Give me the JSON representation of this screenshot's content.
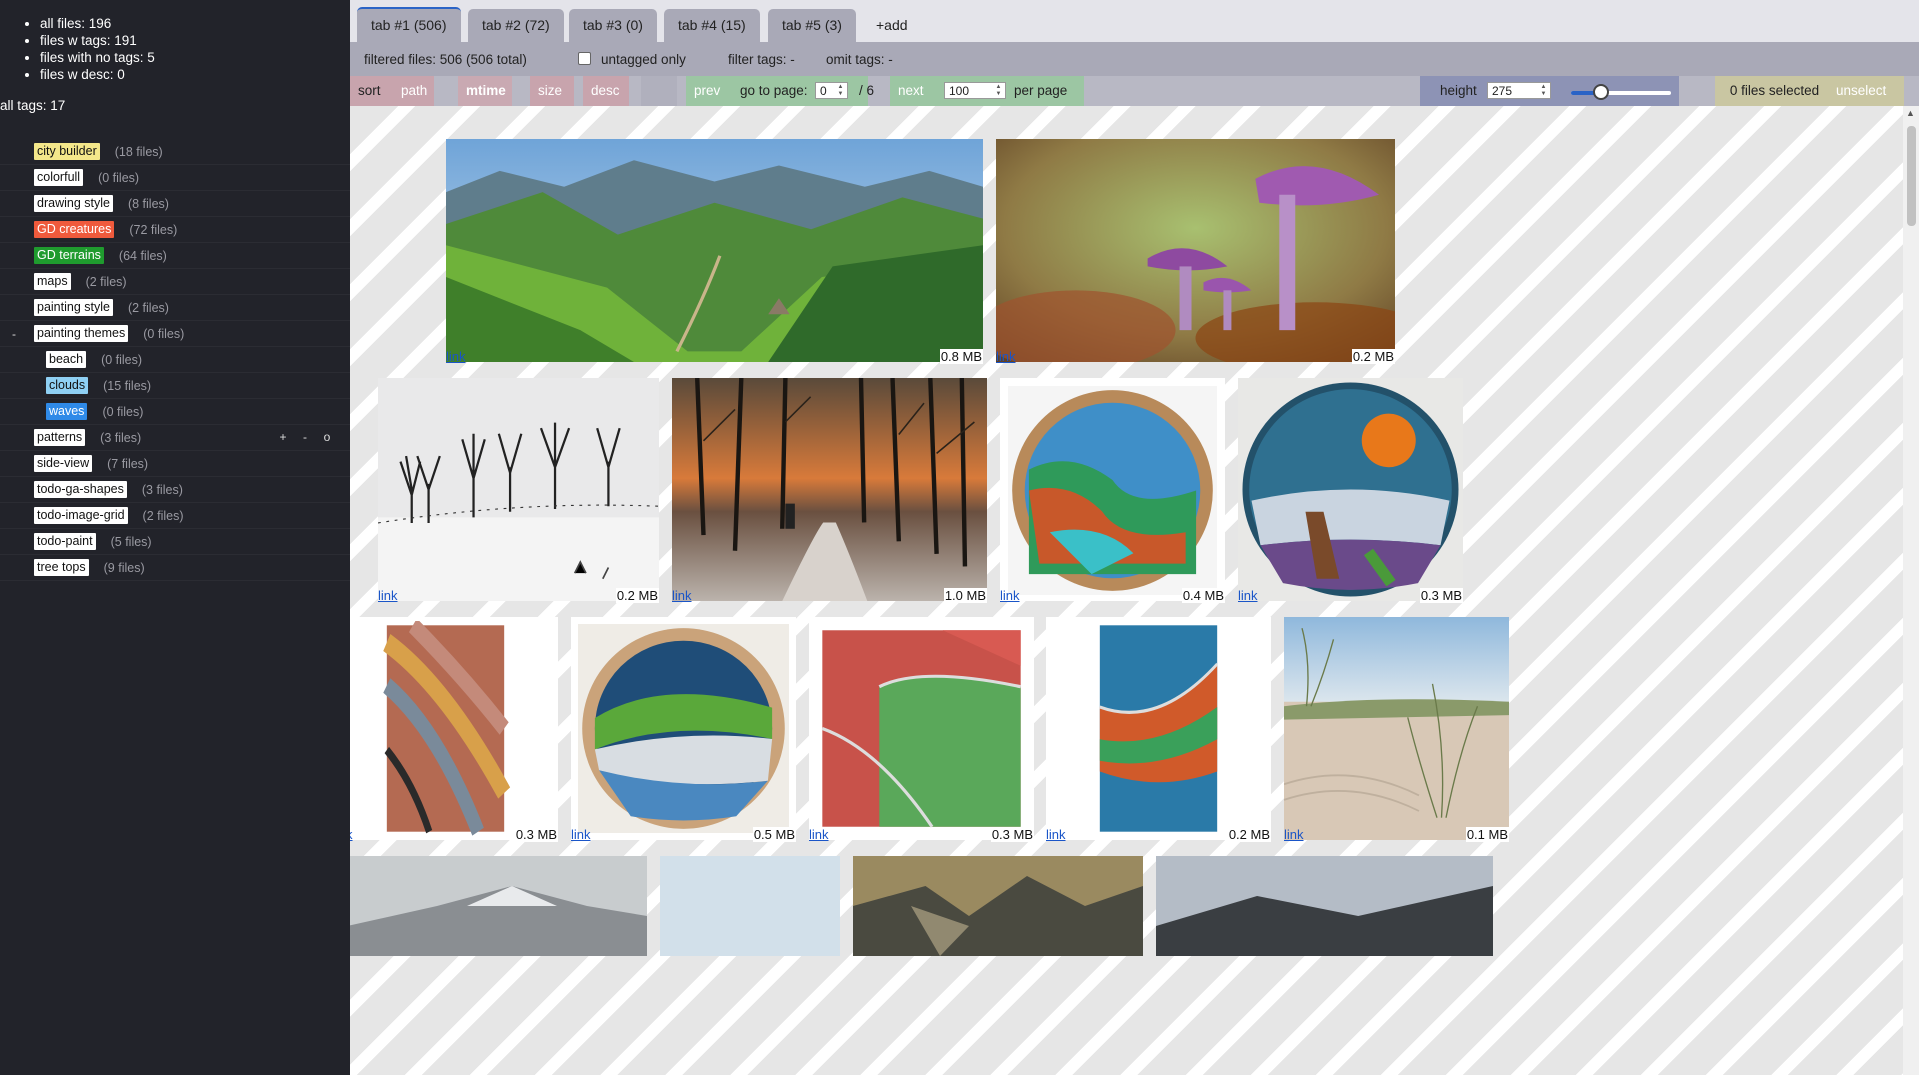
{
  "sidebar": {
    "stats": [
      "all files: 196",
      "files w tags: 191",
      "files with no tags: 5",
      "files w desc: 0"
    ],
    "all_tags": "all tags: 17",
    "tags": [
      {
        "label": "city builder",
        "count": "(18 files)",
        "color": "#f4e78a",
        "text_color": "#111"
      },
      {
        "label": "colorfull",
        "count": "(0 files)",
        "color": "#ffffff",
        "text_color": "#111"
      },
      {
        "label": "drawing style",
        "count": "(8 files)",
        "color": "#ffffff",
        "text_color": "#111"
      },
      {
        "label": "GD creatures",
        "count": "(72 files)",
        "color": "#ef5a3c",
        "text_color": "#fff"
      },
      {
        "label": "GD terrains",
        "count": "(64 files)",
        "color": "#1f9b2e",
        "text_color": "#fff"
      },
      {
        "label": "maps",
        "count": "(2 files)",
        "color": "#ffffff",
        "text_color": "#111"
      },
      {
        "label": "painting style",
        "count": "(2 files)",
        "color": "#ffffff",
        "text_color": "#111"
      },
      {
        "label": "painting themes",
        "count": "(0 files)",
        "color": "#ffffff",
        "text_color": "#111",
        "expander": "-"
      },
      {
        "label": "beach",
        "count": "(0 files)",
        "color": "#ffffff",
        "text_color": "#111",
        "child": true
      },
      {
        "label": "clouds",
        "count": "(15 files)",
        "color": "#8fd0f4",
        "text_color": "#111",
        "child": true
      },
      {
        "label": "waves",
        "count": "(0 files)",
        "color": "#2f8ae8",
        "text_color": "#fff",
        "child": true
      },
      {
        "label": "patterns",
        "count": "(3 files)",
        "color": "#ffffff",
        "text_color": "#111",
        "tools": [
          "+",
          "-",
          "o"
        ]
      },
      {
        "label": "side-view",
        "count": "(7 files)",
        "color": "#ffffff",
        "text_color": "#111"
      },
      {
        "label": "todo-ga-shapes",
        "count": "(3 files)",
        "color": "#ffffff",
        "text_color": "#111"
      },
      {
        "label": "todo-image-grid",
        "count": "(2 files)",
        "color": "#ffffff",
        "text_color": "#111"
      },
      {
        "label": "todo-paint",
        "count": "(5 files)",
        "color": "#ffffff",
        "text_color": "#111"
      },
      {
        "label": "tree tops",
        "count": "(9 files)",
        "color": "#ffffff",
        "text_color": "#111"
      }
    ]
  },
  "tabs": [
    {
      "label": "tab #1 (506)",
      "active": true
    },
    {
      "label": "tab #2 (72)"
    },
    {
      "label": "tab #3 (0)"
    },
    {
      "label": "tab #4 (15)"
    },
    {
      "label": "tab #5 (3)"
    }
  ],
  "add_tab_label": "+add",
  "filter": {
    "filtered": "filtered files: 506 (506 total)",
    "untagged_only": "untagged only",
    "filter_tags": "filter tags: -",
    "omit_tags": "omit tags: -"
  },
  "toolbar": {
    "sort": "sort",
    "path": "path",
    "mtime": "mtime",
    "size": "size",
    "desc": "desc",
    "prev": "prev",
    "goto": "go to page:",
    "page_value": "0",
    "page_total": "/ 6",
    "next": "next",
    "per_page_value": "100",
    "per_page": "per page",
    "height": "height",
    "height_value": "275",
    "slider_fraction": 0.3,
    "selected": "0 files selected",
    "unselect": "unselect"
  },
  "gallery": {
    "link_label": "link",
    "items": [
      {
        "size": "0.8 MB",
        "scene": "valley"
      },
      {
        "size": "0.2 MB",
        "scene": "mushroom"
      },
      {
        "size": "0.2 MB",
        "scene": "snow-trees"
      },
      {
        "size": "1.0 MB",
        "scene": "forest-sunset"
      },
      {
        "size": "0.4 MB",
        "scene": "mosaic-round-a"
      },
      {
        "size": "0.3 MB",
        "scene": "mosaic-round-b"
      },
      {
        "size": "0.3 MB",
        "scene": "mosaic-stones"
      },
      {
        "size": "0.5 MB",
        "scene": "mosaic-round-c"
      },
      {
        "size": "0.3 MB",
        "scene": "mosaic-green"
      },
      {
        "size": "0.2 MB",
        "scene": "mosaic-blue"
      },
      {
        "size": "0.1 MB",
        "scene": "dunes"
      },
      {
        "scene": "mountain-grey"
      },
      {
        "scene": "sky"
      },
      {
        "scene": "mountain-gold"
      },
      {
        "scene": "mountain-dark"
      }
    ]
  },
  "colors": {
    "accent": "#2a63c6",
    "sidebar_bg": "#22232a",
    "sort_bg": "#c8a4ad",
    "nav_bg": "#9cc6a3",
    "height_bg": "#8d93b5",
    "select_bg": "#c9c6a2"
  }
}
